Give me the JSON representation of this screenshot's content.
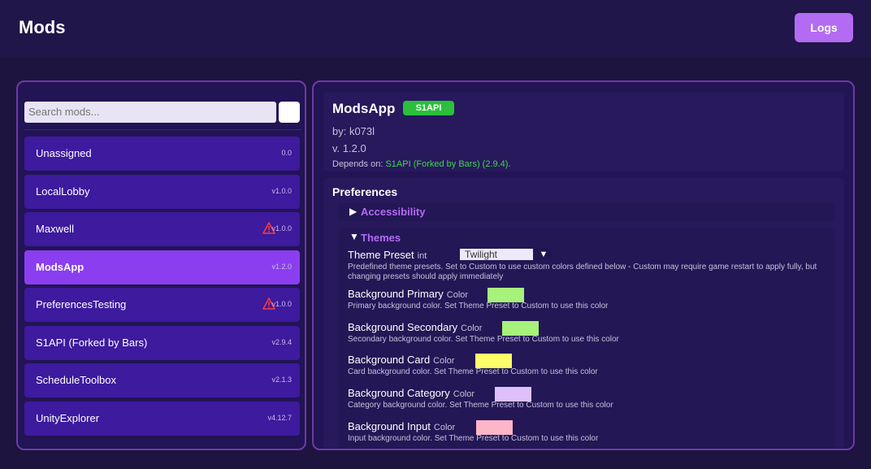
{
  "header": {
    "title": "Mods",
    "logs_label": "Logs"
  },
  "search": {
    "placeholder": "Search mods..."
  },
  "mods": [
    {
      "name": "Unassigned",
      "version": "0.0",
      "warning": false,
      "active": false
    },
    {
      "name": "LocalLobby",
      "version": "v1.0.0",
      "warning": false,
      "active": false
    },
    {
      "name": "Maxwell",
      "version": "v1.0.0",
      "warning": true,
      "active": false
    },
    {
      "name": "ModsApp",
      "version": "v1.2.0",
      "warning": false,
      "active": true
    },
    {
      "name": "PreferencesTesting",
      "version": "v1.0.0",
      "warning": true,
      "active": false
    },
    {
      "name": "S1API (Forked by Bars)",
      "version": "v2.9.4",
      "warning": false,
      "active": false
    },
    {
      "name": "ScheduleToolbox",
      "version": "v2.1.3",
      "warning": false,
      "active": false
    },
    {
      "name": "UnityExplorer",
      "version": "v4.12.7",
      "warning": false,
      "active": false
    }
  ],
  "detail": {
    "name": "ModsApp",
    "badge": "S1API",
    "author": "by: k073l",
    "version": "v. 1.2.0",
    "depends_label": "Depends on:",
    "depends_value": "S1API (Forked by Bars) (2.9.4)."
  },
  "preferences": {
    "heading": "Preferences",
    "accessibility_label": "Accessibility",
    "themes_label": "Themes",
    "theme_preset": {
      "label": "Theme Preset",
      "type": "int",
      "value": "Twilight",
      "description": "Predefined theme presets. Set to Custom to use custom colors defined below - Custom may require game restart to apply fully, but changing presets should apply immediately"
    },
    "items": [
      {
        "label": "Background Primary",
        "type": "Color",
        "color": "#a6f27a",
        "description": "Primary background color. Set Theme Preset to Custom to use this color"
      },
      {
        "label": "Background Secondary",
        "type": "Color",
        "color": "#a6f27a",
        "description": "Secondary background color. Set Theme Preset to Custom to use this color"
      },
      {
        "label": "Background Card",
        "type": "Color",
        "color": "#fefe68",
        "description": "Card background color. Set Theme Preset to Custom to use this color"
      },
      {
        "label": "Background Category",
        "type": "Color",
        "color": "#ddc0f9",
        "description": "Category background color. Set Theme Preset to Custom to use this color"
      },
      {
        "label": "Background Input",
        "type": "Color",
        "color": "#fdb6c8",
        "description": "Input background color. Set Theme Preset to Custom to use this color"
      }
    ]
  },
  "colors": {
    "accent": "#b36bf3",
    "active_item": "#8a3ef0",
    "item": "#3d1a9e",
    "badge": "#2bbf3c",
    "warning": "#ff3b3b"
  },
  "icons": {
    "warning": "warning-triangle-icon",
    "collapsed": "triangle-right",
    "expanded": "triangle-down"
  }
}
